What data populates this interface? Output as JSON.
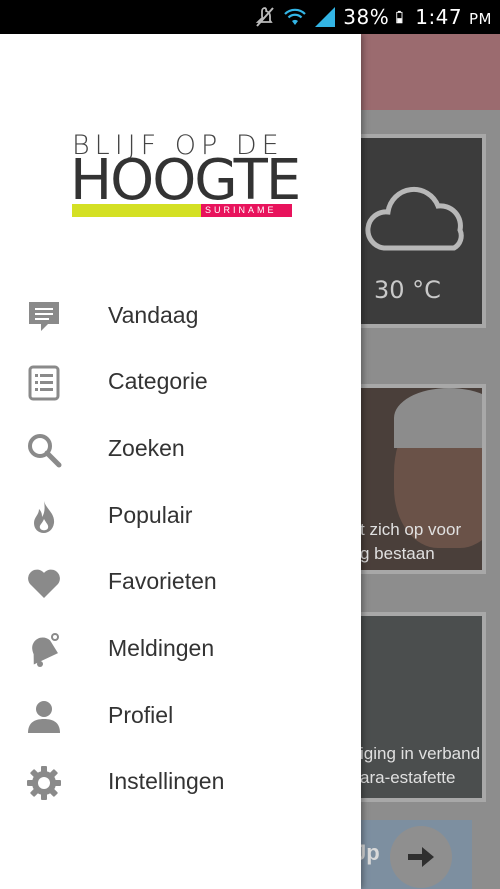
{
  "status_bar": {
    "battery": "38%",
    "time": "1:47",
    "ampm": "PM"
  },
  "drawer": {
    "logo": {
      "line1": "BLIJF OP DE",
      "line2": "HOOGTE",
      "sub": "SURINAME",
      "colors": {
        "yellow": "#d4e024",
        "pink": "#e8135c"
      }
    },
    "menu": [
      {
        "label": "Vandaag",
        "icon": "chat-bubble-icon"
      },
      {
        "label": "Categorie",
        "icon": "list-icon"
      },
      {
        "label": "Zoeken",
        "icon": "search-icon"
      },
      {
        "label": "Populair",
        "icon": "fire-icon"
      },
      {
        "label": "Favorieten",
        "icon": "heart-icon"
      },
      {
        "label": "Meldingen",
        "icon": "bell-icon"
      },
      {
        "label": "Profiel",
        "icon": "person-icon"
      },
      {
        "label": "Instellingen",
        "icon": "gear-icon"
      }
    ]
  },
  "background": {
    "weather_temp": "30 °C",
    "news1_caption": [
      "t zich op voor",
      "g bestaan"
    ],
    "news2_caption": [
      "iging in verband",
      "ara-estafette"
    ],
    "next_partial": "Jp"
  }
}
